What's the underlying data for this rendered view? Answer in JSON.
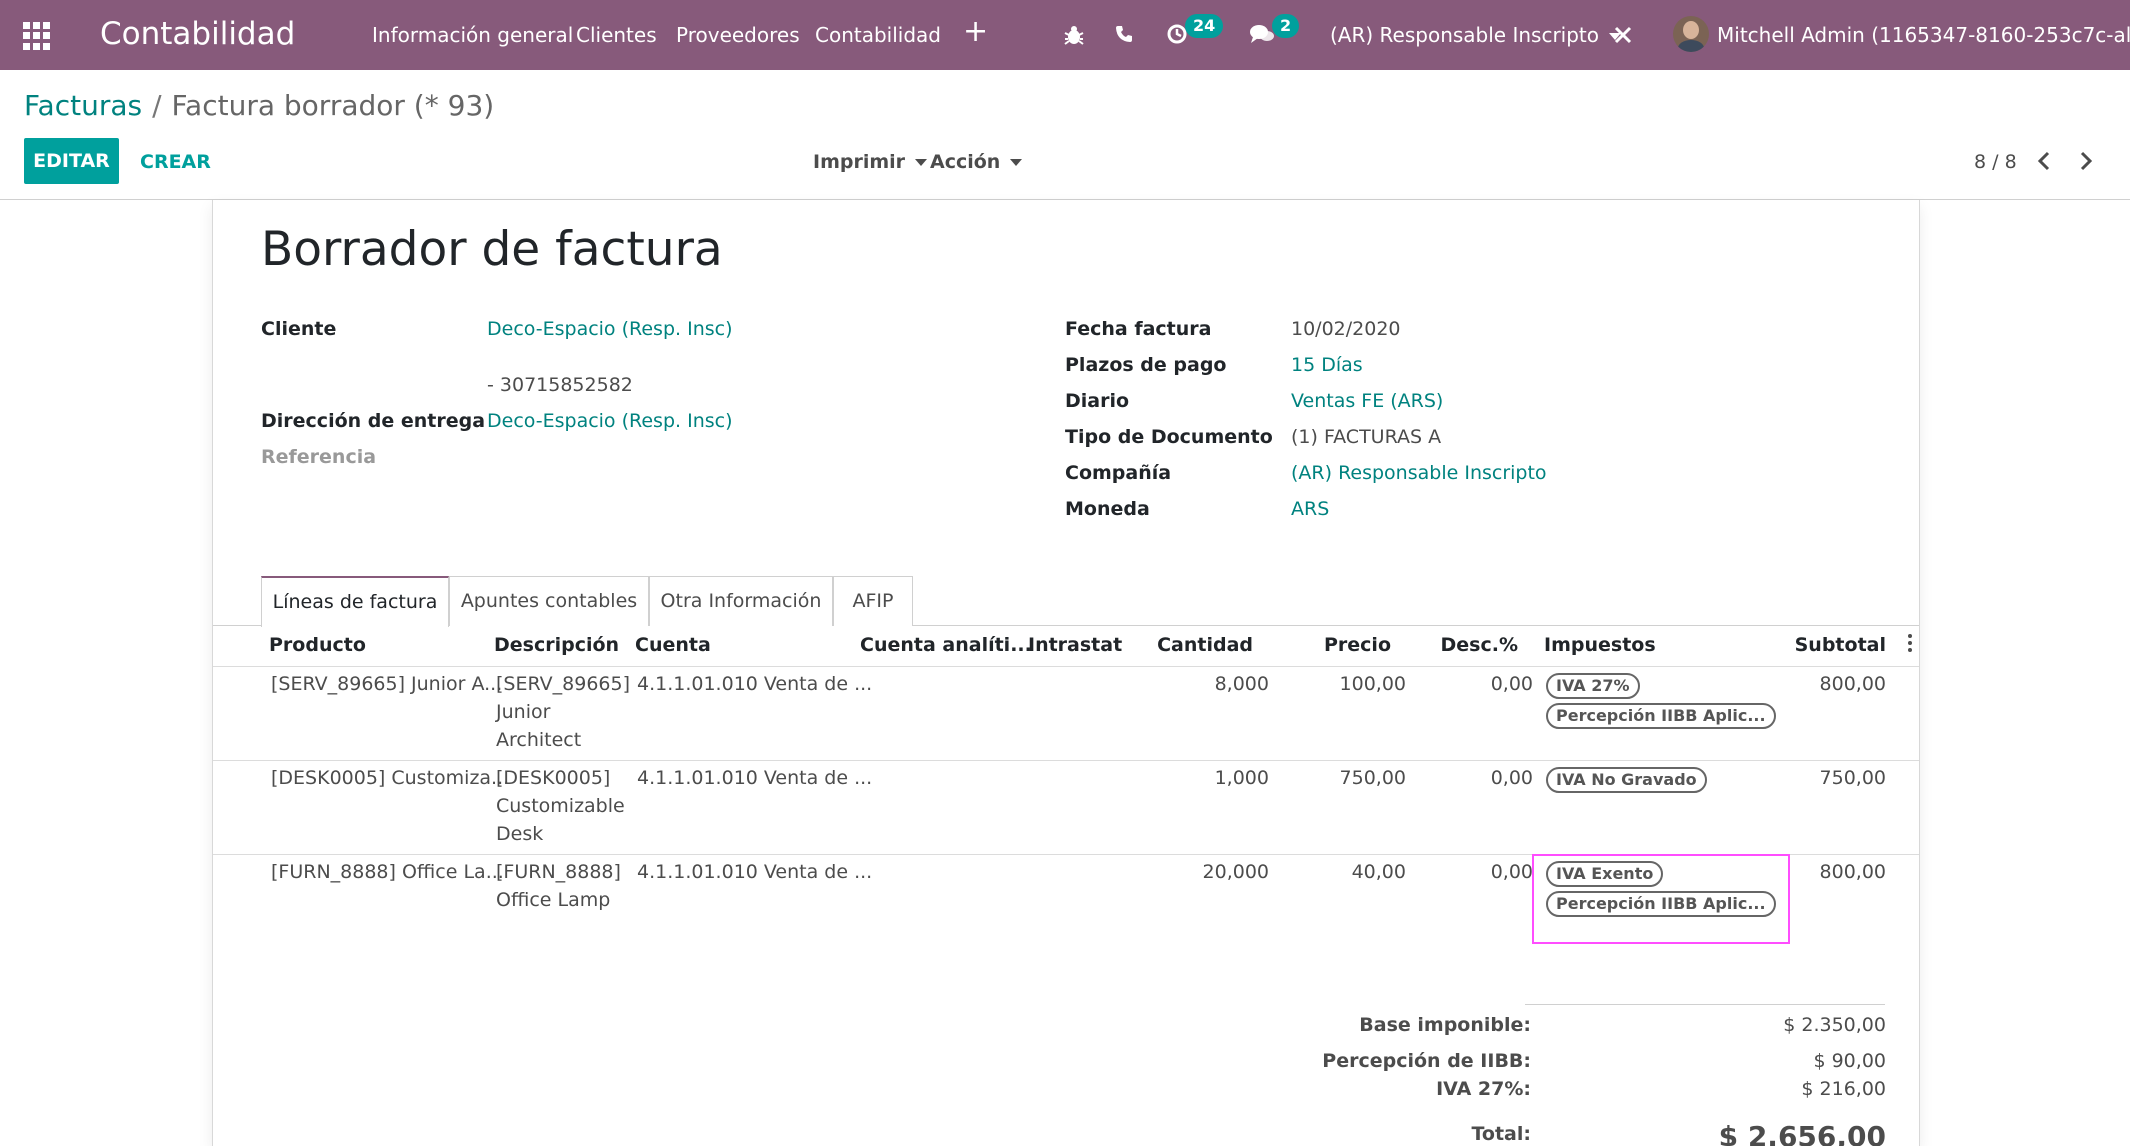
{
  "navbar": {
    "app_name": "Contabilidad",
    "menu": [
      "Información general",
      "Clientes",
      "Proveedores",
      "Contabilidad"
    ],
    "activity_badge": "24",
    "messages_badge": "2",
    "company": "(AR) Responsable Inscripto",
    "user": "Mitchell Admin (1165347-8160-253c7c-all)",
    "icons": [
      "apps-grid-icon",
      "plus-icon",
      "bug-icon",
      "phone-icon",
      "clock-icon",
      "chat-icon",
      "close-icon"
    ]
  },
  "breadcrumb": {
    "parent": "Facturas",
    "sep": "/",
    "current": "Factura borrador (* 93)"
  },
  "actions": {
    "edit": "EDITAR",
    "create": "CREAR",
    "print": "Imprimir",
    "action": "Acción"
  },
  "pager": {
    "value": "8 / 8"
  },
  "form": {
    "title": "Borrador de factura",
    "left": {
      "customer_label": "Cliente",
      "customer": "Deco-Espacio (Resp. Insc)",
      "customer_vat": "- 30715852582",
      "delivery_label": "Dirección de entrega",
      "delivery": "Deco-Espacio (Resp. Insc)",
      "reference_label": "Referencia"
    },
    "right": {
      "date_label": "Fecha factura",
      "date": "10/02/2020",
      "terms_label": "Plazos de pago",
      "terms": "15 Días",
      "journal_label": "Diario",
      "journal": "Ventas FE (ARS)",
      "doctype_label": "Tipo de Documento",
      "doctype": "(1) FACTURAS A",
      "company_label": "Compañía",
      "company": "(AR) Responsable Inscripto",
      "currency_label": "Moneda",
      "currency": "ARS"
    }
  },
  "tabs": [
    "Líneas de factura",
    "Apuntes contables",
    "Otra Información",
    "AFIP"
  ],
  "table": {
    "headers": [
      "Producto",
      "Descripción",
      "Cuenta",
      "Cuenta analíti...",
      "Intrastat",
      "Cantidad",
      "Precio",
      "Desc.%",
      "Impuestos",
      "Subtotal"
    ],
    "rows": [
      {
        "product": "[SERV_89665] Junior A...",
        "desc": [
          "[SERV_89665]",
          "Junior",
          "Architect"
        ],
        "account": "4.1.1.01.010 Venta de ...",
        "qty": "8,000",
        "price": "100,00",
        "disc": "0,00",
        "taxes": [
          "IVA 27%",
          "Percepción IIBB Aplic..."
        ],
        "subtotal": "800,00"
      },
      {
        "product": "[DESK0005] Customiza...",
        "desc": [
          "[DESK0005]",
          "Customizable",
          "Desk"
        ],
        "account": "4.1.1.01.010 Venta de ...",
        "qty": "1,000",
        "price": "750,00",
        "disc": "0,00",
        "taxes": [
          "IVA No Gravado"
        ],
        "subtotal": "750,00"
      },
      {
        "product": "[FURN_8888] Office La...",
        "desc": [
          "[FURN_8888]",
          "Office Lamp"
        ],
        "account": "4.1.1.01.010 Venta de ...",
        "qty": "20,000",
        "price": "40,00",
        "disc": "0,00",
        "taxes": [
          "IVA Exento",
          "Percepción IIBB Aplic..."
        ],
        "subtotal": "800,00"
      }
    ]
  },
  "totals": {
    "base_label": "Base imponible:",
    "base": "$ 2.350,00",
    "iibb_label": "Percepción de IIBB:",
    "iibb": "$ 90,00",
    "iva_label": "IVA 27%:",
    "iva": "$ 216,00",
    "total_label": "Total:",
    "total": "$ 2.656,00"
  },
  "colors": {
    "navbar": "#875a7b",
    "accent": "#00a09d",
    "link": "#00827f",
    "highlight": "#ff4dff"
  }
}
